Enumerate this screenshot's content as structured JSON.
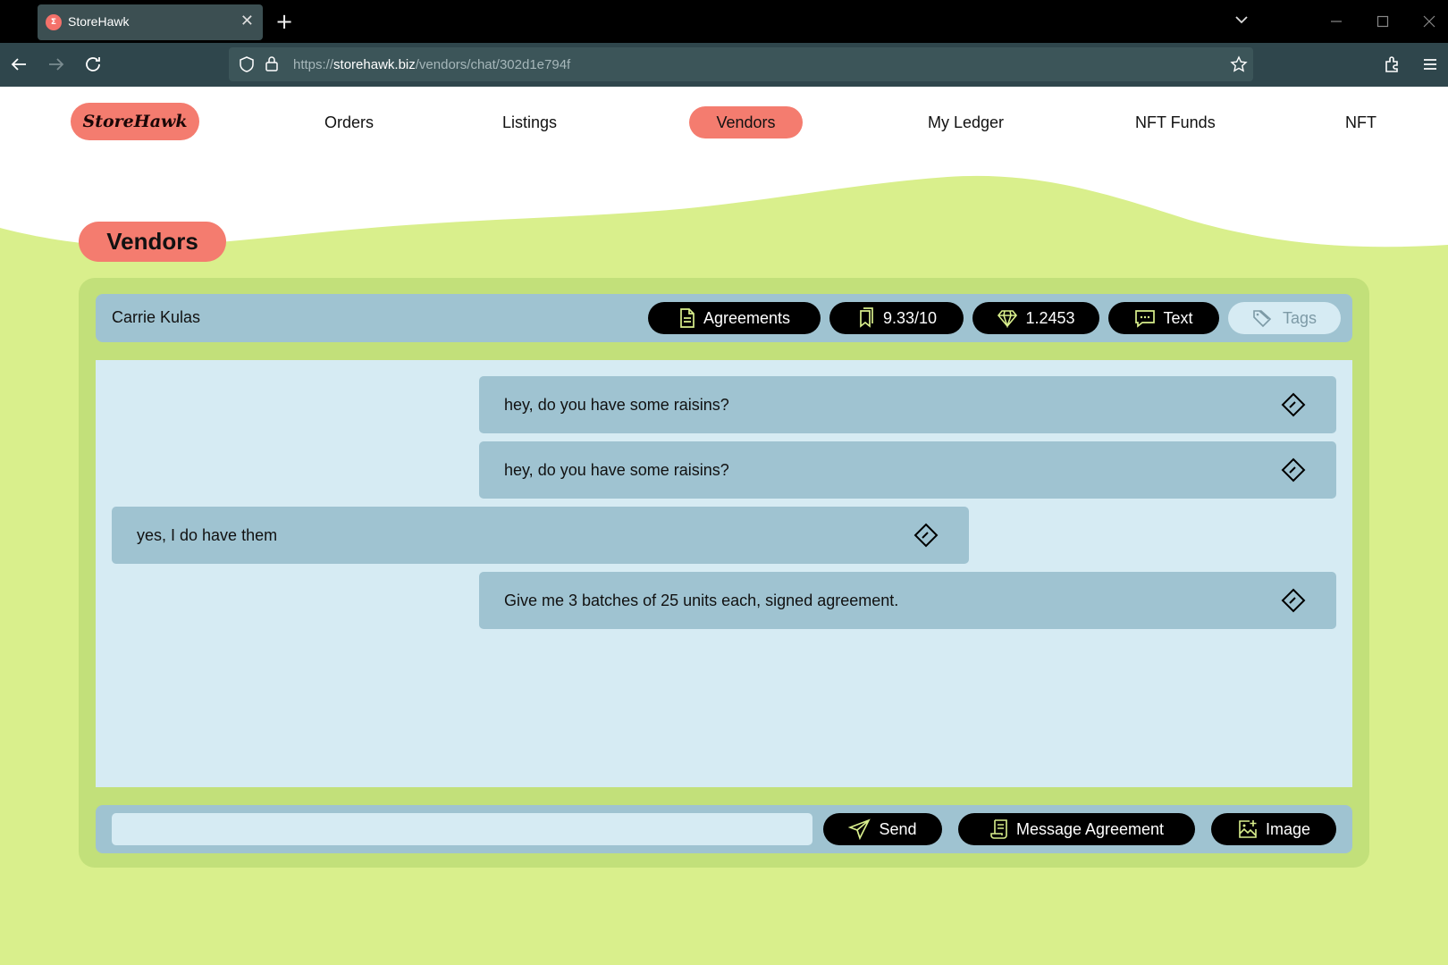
{
  "browser": {
    "tab_title": "StoreHawk",
    "favicon_text": "Σ",
    "tab_close": "✕",
    "new_tab": "+",
    "url_prefix": "https://",
    "url_host": "storehawk.biz",
    "url_path": "/vendors/chat/302d1e794f"
  },
  "site": {
    "logo": "StoreHawk",
    "nav": [
      "Orders",
      "Listings",
      "Vendors",
      "My Ledger",
      "NFT Funds",
      "NFT"
    ],
    "active_nav": "Vendors"
  },
  "page_title": "Vendors",
  "chat": {
    "contact_name": "Carrie Kulas",
    "actions": {
      "agreements": "Agreements",
      "rating": "9.33/10",
      "balance": "1.2453",
      "text": "Text",
      "tags": "Tags"
    },
    "messages": [
      {
        "text": "hey, do you have some raisins?",
        "side": "right"
      },
      {
        "text": "hey, do you have some raisins?",
        "side": "right"
      },
      {
        "text": "yes, I do have them",
        "side": "left"
      },
      {
        "text": "Give me 3 batches of 25 units each, signed agreement.",
        "side": "right"
      }
    ]
  },
  "composer": {
    "value": "",
    "send": "Send",
    "message_agreement": "Message Agreement",
    "image": "Image"
  },
  "colors": {
    "accent": "#f47c6f",
    "background": "#d9ef8c",
    "panel": "#c2e07a",
    "bubble": "#9fc3d1",
    "chat_bg": "#d6ebf3"
  }
}
